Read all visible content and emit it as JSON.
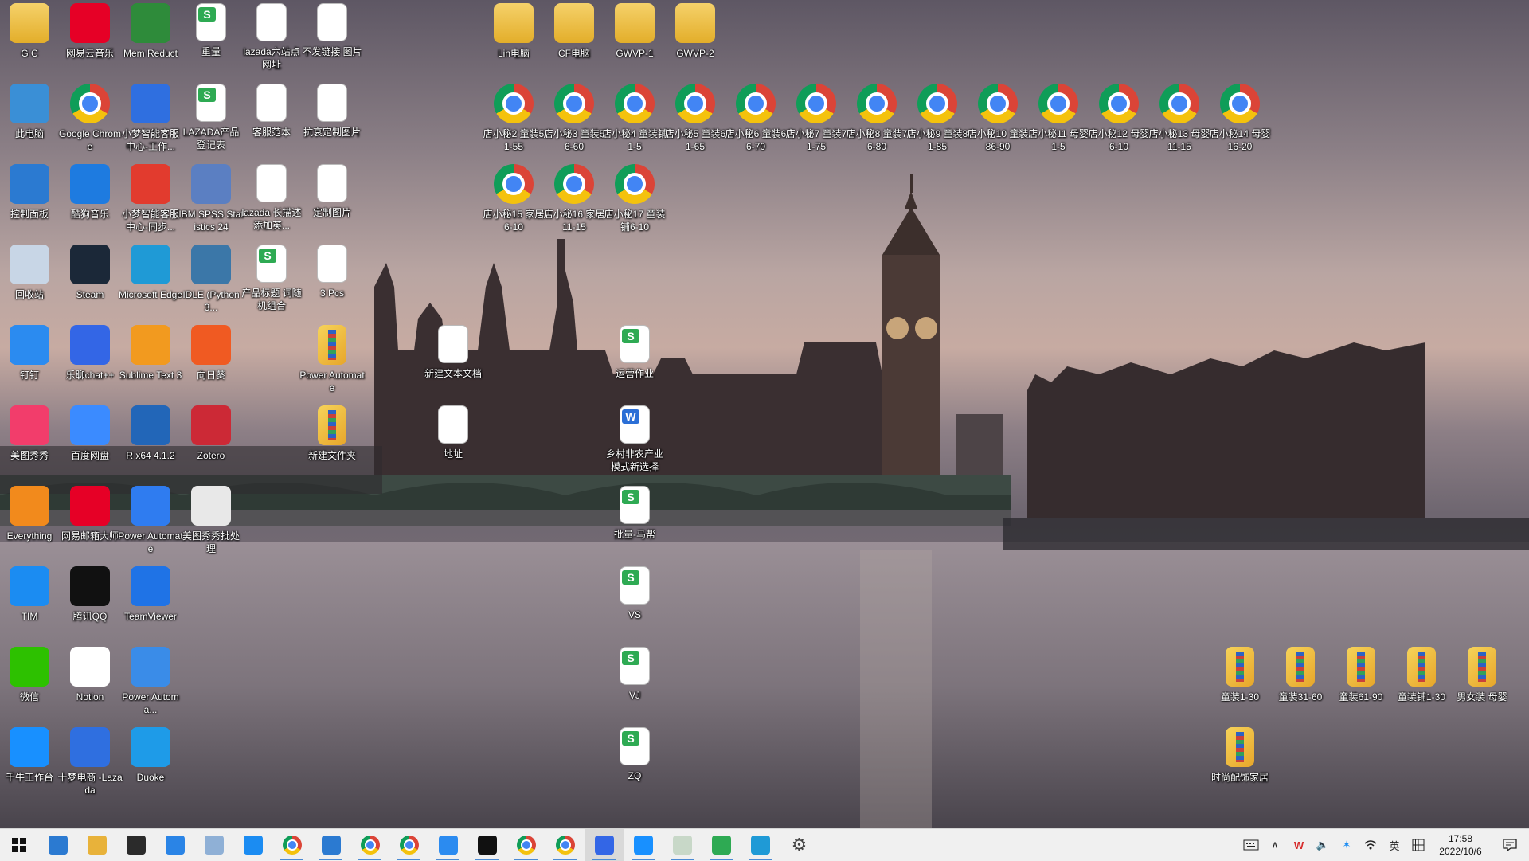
{
  "desktop": {
    "icons": [
      {
        "label": "G C",
        "kind": "user-folder-icon",
        "color": "#e8b23a"
      },
      {
        "label": "网易云音乐",
        "kind": "netease-music-icon",
        "color": "#e60026"
      },
      {
        "label": "Mem Reduct",
        "kind": "memory-chip-icon",
        "color": "#2e8b3a"
      },
      {
        "label": "重量",
        "kind": "spreadsheet-icon",
        "color": "#2eaa53"
      },
      {
        "label": "lazada六站点网址",
        "kind": "text-document-icon",
        "color": "#ffffff"
      },
      {
        "label": "不发链接 图片",
        "kind": "image-file-icon",
        "color": "#ffffff"
      },
      {
        "label": "此电脑",
        "kind": "computer-icon",
        "color": "#3a8fd6"
      },
      {
        "label": "Google Chrome",
        "kind": "chrome-icon",
        "color": "#4285f4"
      },
      {
        "label": "小梦智能客服中心-工作...",
        "kind": "xiaomeng-icon",
        "color": "#2f6fe0"
      },
      {
        "label": "LAZADA产品登记表",
        "kind": "spreadsheet-icon",
        "color": "#2eaa53"
      },
      {
        "label": "客服范本",
        "kind": "text-document-icon",
        "color": "#ffffff"
      },
      {
        "label": "抗衰定制图片",
        "kind": "image-file-icon",
        "color": "#ffffff"
      },
      {
        "label": "控制面板",
        "kind": "control-panel-icon",
        "color": "#2b7ad1"
      },
      {
        "label": "酷狗音乐",
        "kind": "kugou-icon",
        "color": "#1e7be0"
      },
      {
        "label": "小梦智能客服中心-同步...",
        "kind": "xiaomeng-red-icon",
        "color": "#e23b2e"
      },
      {
        "label": "IBM SPSS Statistics 24",
        "kind": "spss-icon",
        "color": "#5b7fc2"
      },
      {
        "label": "lazada 长描述 添加英...",
        "kind": "text-document-icon",
        "color": "#ffffff"
      },
      {
        "label": "定制图片",
        "kind": "image-file-icon",
        "color": "#ffffff"
      },
      {
        "label": "回收站",
        "kind": "recycle-bin-icon",
        "color": "#c8d6e6"
      },
      {
        "label": "Steam",
        "kind": "steam-icon",
        "color": "#1b2838"
      },
      {
        "label": "Microsoft Edge",
        "kind": "edge-icon",
        "color": "#1f9ad6"
      },
      {
        "label": "IDLE (Python 3...",
        "kind": "python-icon",
        "color": "#3b77a8"
      },
      {
        "label": "产品标题 词随机组合",
        "kind": "spreadsheet-icon",
        "color": "#2eaa53"
      },
      {
        "label": "3 Pcs",
        "kind": "image-file-icon",
        "color": "#ffffff"
      },
      {
        "label": "钉钉",
        "kind": "dingtalk-icon",
        "color": "#2b8bf0"
      },
      {
        "label": "乐聊chat++",
        "kind": "lechat-icon",
        "color": "#3366e6"
      },
      {
        "label": "Sublime Text 3",
        "kind": "sublime-icon",
        "color": "#f29a1f"
      },
      {
        "label": "向日葵",
        "kind": "sunlogin-icon",
        "color": "#f05a22"
      },
      {
        "label": "Power Automate",
        "kind": "archive-folder-icon",
        "color": "#e9b43a"
      },
      {
        "label": "美图秀秀",
        "kind": "meitu-icon",
        "color": "#f23d6b"
      },
      {
        "label": "百度网盘",
        "kind": "baidu-pan-icon",
        "color": "#3b8bff"
      },
      {
        "label": "R x64 4.1.2",
        "kind": "r-lang-icon",
        "color": "#2266b8"
      },
      {
        "label": "Zotero",
        "kind": "zotero-icon",
        "color": "#cc2936"
      },
      {
        "label": "新建文件夹",
        "kind": "archive-folder-icon",
        "color": "#e9b43a"
      },
      {
        "label": "Everything",
        "kind": "everything-search-icon",
        "color": "#f28a1c"
      },
      {
        "label": "网易邮箱大师",
        "kind": "netease-mail-icon",
        "color": "#e60026"
      },
      {
        "label": "Power Automate",
        "kind": "power-automate-icon",
        "color": "#2f7cf0"
      },
      {
        "label": "美图秀秀批处理",
        "kind": "meitu-batch-icon",
        "color": "#e8e8e8"
      },
      {
        "label": "TIM",
        "kind": "tim-icon",
        "color": "#1b8cf2"
      },
      {
        "label": "腾讯QQ",
        "kind": "qq-icon",
        "color": "#111111"
      },
      {
        "label": "TeamViewer",
        "kind": "teamviewer-icon",
        "color": "#1f73e6"
      },
      {
        "label": "微信",
        "kind": "wechat-icon",
        "color": "#2dc100"
      },
      {
        "label": "Notion",
        "kind": "notion-icon",
        "color": "#ffffff"
      },
      {
        "label": "Power Automa...",
        "kind": "power-automate-desktop-icon",
        "color": "#3a8ce8"
      },
      {
        "label": "千牛工作台",
        "kind": "qianniu-icon",
        "color": "#1890ff"
      },
      {
        "label": "十梦电商 -Lazada",
        "kind": "shimeng-icon",
        "color": "#2f6fe0"
      },
      {
        "label": "Duoke",
        "kind": "duoke-icon",
        "color": "#1e9be8"
      },
      {
        "label": "Lin电脑",
        "kind": "folder-icon",
        "color": "#e8b23a"
      },
      {
        "label": "CF电脑",
        "kind": "folder-icon",
        "color": "#e8b23a"
      },
      {
        "label": "GWVP-1",
        "kind": "folder-icon",
        "color": "#e8b23a"
      },
      {
        "label": "GWVP-2",
        "kind": "folder-icon",
        "color": "#e8b23a"
      },
      {
        "label": "店小秘2 童装51-55",
        "kind": "chrome-icon",
        "color": "#4285f4"
      },
      {
        "label": "店小秘3 童装56-60",
        "kind": "chrome-icon",
        "color": "#4285f4"
      },
      {
        "label": "店小秘4 童装铺1-5",
        "kind": "chrome-icon",
        "color": "#4285f4"
      },
      {
        "label": "店小秘5 童装61-65",
        "kind": "chrome-icon",
        "color": "#4285f4"
      },
      {
        "label": "店小秘6 童装66-70",
        "kind": "chrome-icon",
        "color": "#4285f4"
      },
      {
        "label": "店小秘7 童装71-75",
        "kind": "chrome-icon",
        "color": "#4285f4"
      },
      {
        "label": "店小秘8 童装76-80",
        "kind": "chrome-icon",
        "color": "#4285f4"
      },
      {
        "label": "店小秘9 童装81-85",
        "kind": "chrome-icon",
        "color": "#4285f4"
      },
      {
        "label": "店小秘10 童装86-90",
        "kind": "chrome-icon",
        "color": "#4285f4"
      },
      {
        "label": "店小秘11 母婴1-5",
        "kind": "chrome-icon",
        "color": "#4285f4"
      },
      {
        "label": "店小秘12 母婴6-10",
        "kind": "chrome-icon",
        "color": "#4285f4"
      },
      {
        "label": "店小秘13 母婴11-15",
        "kind": "chrome-icon",
        "color": "#4285f4"
      },
      {
        "label": "店小秘14 母婴16-20",
        "kind": "chrome-icon",
        "color": "#4285f4"
      },
      {
        "label": "店小秘15 家居6-10",
        "kind": "chrome-icon",
        "color": "#4285f4"
      },
      {
        "label": "店小秘16 家居11-15",
        "kind": "chrome-icon",
        "color": "#4285f4"
      },
      {
        "label": "店小秘17 童装铺6-10",
        "kind": "chrome-icon",
        "color": "#4285f4"
      },
      {
        "label": "新建文本文档",
        "kind": "text-document-icon",
        "color": "#ffffff"
      },
      {
        "label": "地址",
        "kind": "text-document-icon",
        "color": "#ffffff"
      },
      {
        "label": "运营作业",
        "kind": "spreadsheet-icon",
        "color": "#2eaa53"
      },
      {
        "label": "乡村非农产业模式新选择",
        "kind": "word-document-icon",
        "color": "#2b6fd6"
      },
      {
        "label": "批量-马帮",
        "kind": "spreadsheet-icon",
        "color": "#2eaa53"
      },
      {
        "label": "VS",
        "kind": "spreadsheet-icon",
        "color": "#2eaa53"
      },
      {
        "label": "VJ",
        "kind": "spreadsheet-icon",
        "color": "#2eaa53"
      },
      {
        "label": "ZQ",
        "kind": "spreadsheet-icon",
        "color": "#2eaa53"
      },
      {
        "label": "童装1-30",
        "kind": "archive-folder-icon",
        "color": "#e9b43a"
      },
      {
        "label": "童装31-60",
        "kind": "archive-folder-icon",
        "color": "#e9b43a"
      },
      {
        "label": "童装61-90",
        "kind": "archive-folder-icon",
        "color": "#e9b43a"
      },
      {
        "label": "童装铺1-30",
        "kind": "archive-folder-icon",
        "color": "#e9b43a"
      },
      {
        "label": "男女装 母婴",
        "kind": "archive-folder-icon",
        "color": "#e9b43a"
      },
      {
        "label": "时尚配饰家居",
        "kind": "archive-folder-icon",
        "color": "#e9b43a"
      }
    ]
  },
  "taskbar": {
    "apps": [
      {
        "name": "start-button",
        "icon": "windows-logo-icon",
        "color": "#1f1f1f"
      },
      {
        "name": "task-view-button",
        "icon": "task-view-icon",
        "color": "#2b7ad1"
      },
      {
        "name": "file-explorer-button",
        "icon": "folder-icon",
        "color": "#e8b23a"
      },
      {
        "name": "sticky-notes-button",
        "icon": "sticky-notes-icon",
        "color": "#2b2b2b"
      },
      {
        "name": "checkmark-app-button",
        "icon": "check-circle-icon",
        "color": "#2a84e6"
      },
      {
        "name": "r-app-button",
        "icon": "r-icon",
        "color": "#8fb0d6"
      },
      {
        "name": "tim-button",
        "icon": "tim-icon",
        "color": "#1b8cf2"
      },
      {
        "name": "chrome-button-1",
        "icon": "chrome-icon",
        "color": "#4285f4"
      },
      {
        "name": "sublime-button",
        "icon": "sublime-icon",
        "color": "#2b7ad1"
      },
      {
        "name": "chrome-button-2",
        "icon": "chrome-icon",
        "color": "#4285f4"
      },
      {
        "name": "chrome-button-3",
        "icon": "chrome-icon",
        "color": "#4285f4"
      },
      {
        "name": "dingtalk-button",
        "icon": "dingtalk-icon",
        "color": "#2b8bf0"
      },
      {
        "name": "notion-button",
        "icon": "notion-icon",
        "color": "#111111"
      },
      {
        "name": "chrome-button-4",
        "icon": "chrome-icon",
        "color": "#4285f4"
      },
      {
        "name": "chrome-button-5",
        "icon": "chrome-icon",
        "color": "#4285f4"
      },
      {
        "name": "lechat-button",
        "icon": "lechat-icon",
        "color": "#3366e6"
      },
      {
        "name": "qianniu-button",
        "icon": "qianniu-icon",
        "color": "#1890ff"
      },
      {
        "name": "notepad-button",
        "icon": "notepad-icon",
        "color": "#c8d8c8"
      },
      {
        "name": "projector-button",
        "icon": "projector-icon",
        "color": "#2eaa53"
      },
      {
        "name": "edge-button",
        "icon": "edge-icon",
        "color": "#1f9ad6"
      },
      {
        "name": "settings-button",
        "icon": "gear-icon",
        "color": "#444444"
      }
    ],
    "tray": {
      "ime_label": "英",
      "time": "17:58",
      "date": "2022/10/6"
    }
  }
}
